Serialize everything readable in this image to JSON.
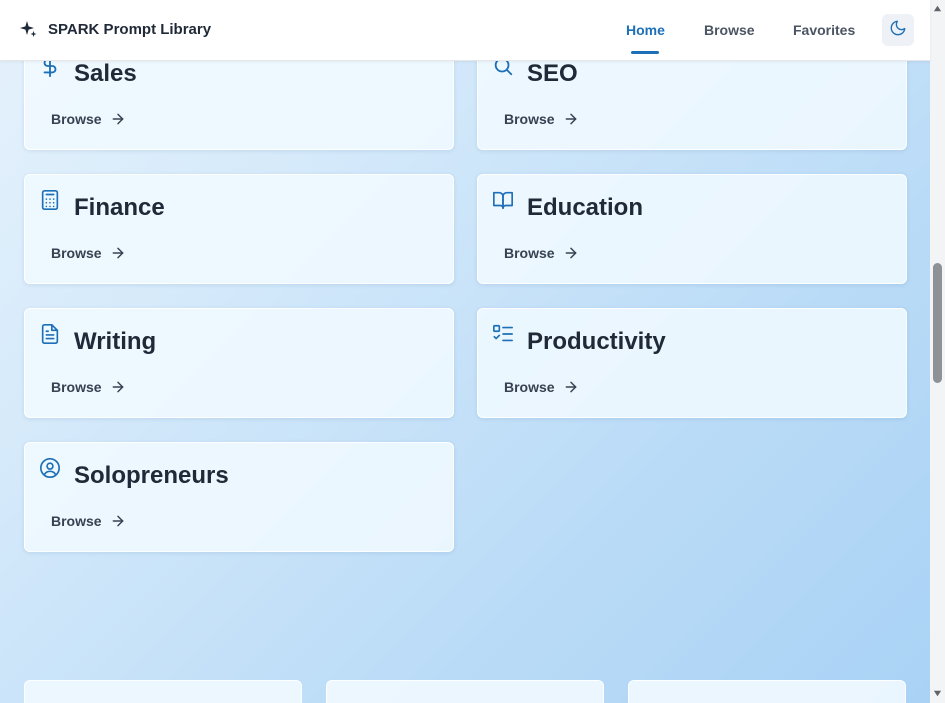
{
  "app": {
    "title": "SPARK Prompt Library",
    "brand_icon": "sparkles-icon"
  },
  "nav": {
    "items": [
      {
        "label": "Home",
        "active": true
      },
      {
        "label": "Browse",
        "active": false
      },
      {
        "label": "Favorites",
        "active": false
      }
    ],
    "theme_toggle_icon": "moon-icon"
  },
  "categories": [
    {
      "title": "Sales",
      "icon": "dollar-icon",
      "link_label": "Browse"
    },
    {
      "title": "SEO",
      "icon": "search-icon",
      "link_label": "Browse"
    },
    {
      "title": "Finance",
      "icon": "calculator-icon",
      "link_label": "Browse"
    },
    {
      "title": "Education",
      "icon": "book-open-icon",
      "link_label": "Browse"
    },
    {
      "title": "Writing",
      "icon": "file-text-icon",
      "link_label": "Browse"
    },
    {
      "title": "Productivity",
      "icon": "list-checks-icon",
      "link_label": "Browse"
    },
    {
      "title": "Solopreneurs",
      "icon": "user-circle-icon",
      "link_label": "Browse"
    }
  ],
  "colors": {
    "accent": "#1d6fb8",
    "icon": "#1d6fb8",
    "text": "#1f2937",
    "nav_text": "#4b5563"
  }
}
